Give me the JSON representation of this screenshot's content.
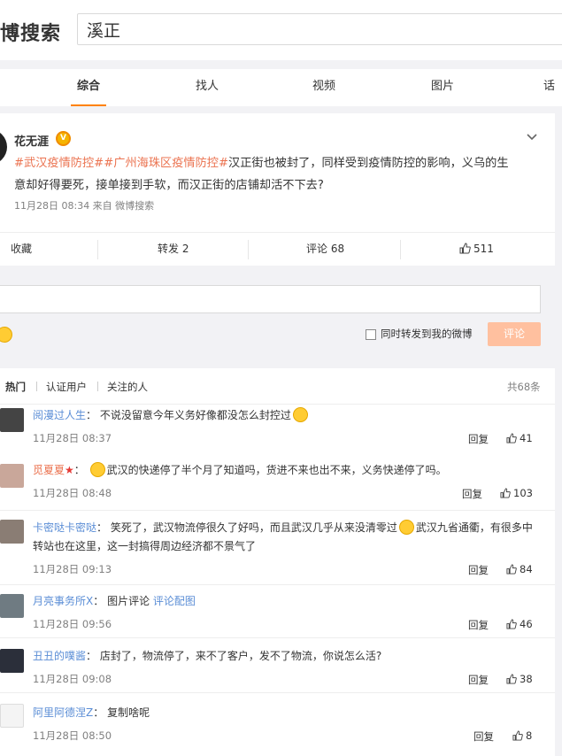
{
  "header": {
    "brand": "博搜索",
    "search_value": "溪正"
  },
  "tabs": [
    {
      "label": "综合",
      "active": true
    },
    {
      "label": "找人",
      "active": false
    },
    {
      "label": "视频",
      "active": false
    },
    {
      "label": "图片",
      "active": false
    },
    {
      "label": "话",
      "active": false
    }
  ],
  "post": {
    "author": "花无涯",
    "tag1": "#武汉疫情防控#",
    "tag2": "#广州海珠区疫情防控#",
    "text_line1_rest": "汉正街也被封了，同样受到疫情防控的影响，义乌的生",
    "text_line2": "意却好得要死，接单接到手软，而汉正街的店铺却活不下去?",
    "meta": "11月28日 08:34  来自 微博搜索"
  },
  "actions": {
    "favorite": "收藏",
    "repost": "转发 2",
    "comment": "评论 68",
    "like": "511"
  },
  "composer": {
    "checkbox_label": "同时转发到我的微博",
    "submit": "评论"
  },
  "filters": {
    "hot": "热门",
    "verified": "认证用户",
    "following": "关注的人",
    "total": "共68条"
  },
  "comments": [
    {
      "user": "阅漫过人生",
      "text": "不说没留意今年义务好像都没怎么封控过",
      "time": "11月28日 08:37",
      "reply": "回复",
      "likes": "41"
    },
    {
      "user": "觅夏夏",
      "text": "武汉的快递停了半个月了知道吗，货进不来也出不来，义务快递停了吗。",
      "time": "11月28日 08:48",
      "reply": "回复",
      "likes": "103"
    },
    {
      "user": "卡密哒卡密哒",
      "text_a": "笑死了，武汉物流停很久了好吗，而且武汉几乎从来没清零过",
      "text_b": "武汉九省通衢，有很多中",
      "text_line2": "转站也在这里，这一封搞得周边经济都不景气了",
      "time": "11月28日 09:13",
      "reply": "回复",
      "likes": "84"
    },
    {
      "user": "月亮事务所X",
      "text": "图片评论",
      "link": "评论配图",
      "time": "11月28日 09:56",
      "reply": "回复",
      "likes": "46"
    },
    {
      "user": "丑丑的噗酱",
      "text": "店封了，物流停了，来不了客户，发不了物流，你说怎么活?",
      "time": "11月28日 09:08",
      "reply": "回复",
      "likes": "38"
    },
    {
      "user": "阿里阿德涅Z",
      "text": "复制啥呢",
      "time": "11月28日 08:50",
      "reply": "回复",
      "likes": "8"
    }
  ],
  "colors": {
    "accent": "#ff8200",
    "link": "#eb7350",
    "submit_disabled": "#ffc09f"
  }
}
